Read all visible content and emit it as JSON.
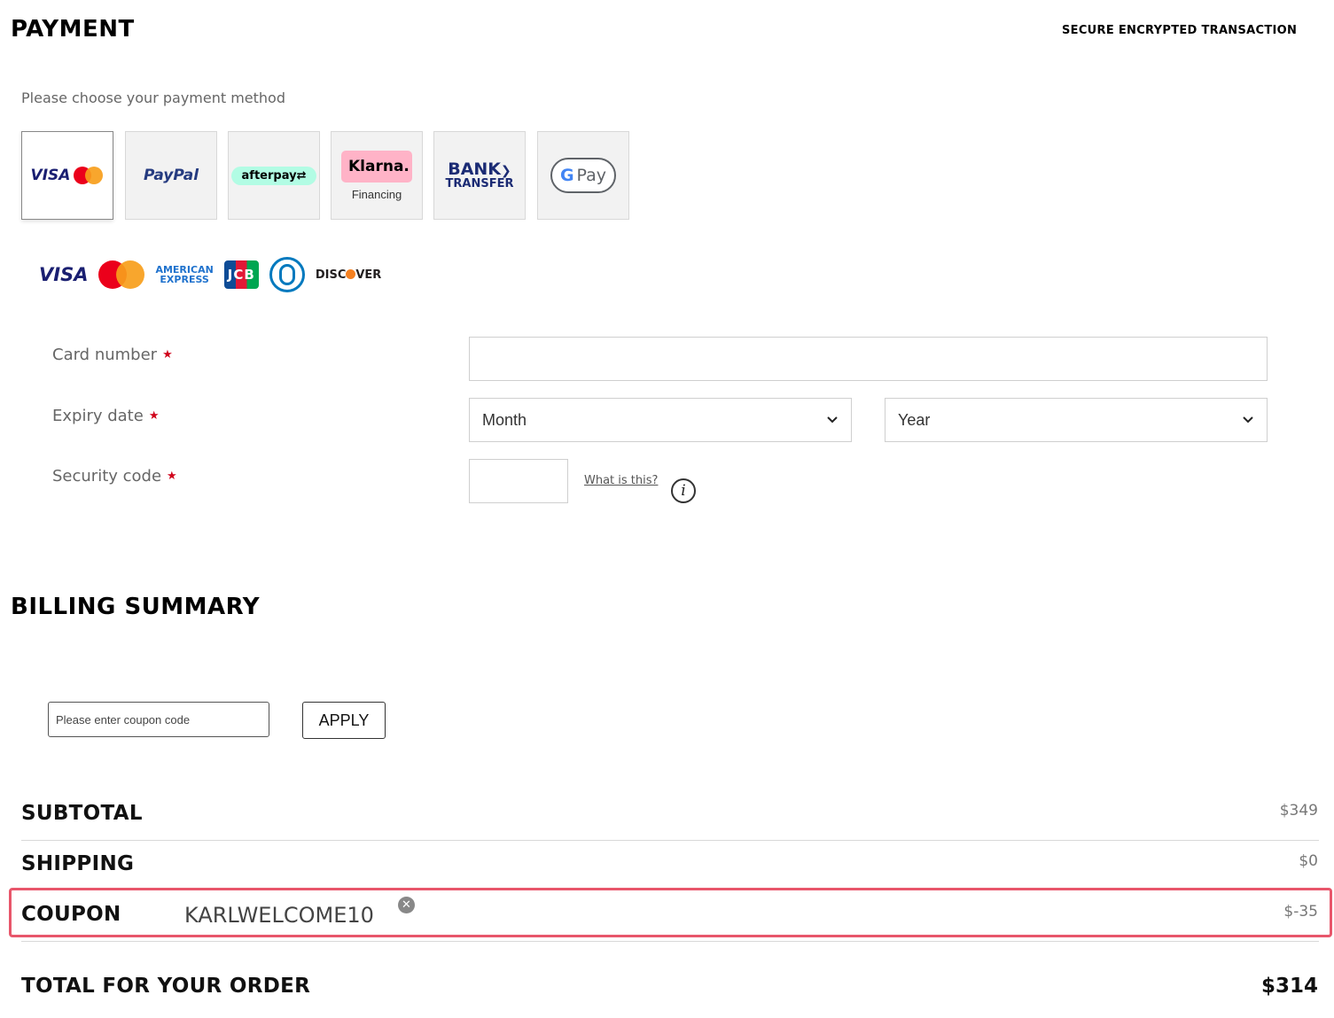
{
  "payment": {
    "title": "PAYMENT",
    "secure_label": "SECURE ENCRYPTED TRANSACTION",
    "choose_label": "Please choose your payment method",
    "methods": [
      {
        "id": "card",
        "label": "VISA",
        "selected": true
      },
      {
        "id": "paypal",
        "label": "PayPal"
      },
      {
        "id": "afterpay",
        "label": "afterpay"
      },
      {
        "id": "klarna",
        "label": "Klarna.",
        "sub": "Financing"
      },
      {
        "id": "bank",
        "label_line1": "BANK",
        "label_line2": "TRANSFER"
      },
      {
        "id": "gpay",
        "label": "Pay"
      }
    ],
    "card_brands": {
      "visa": "VISA",
      "amex_line1": "AMERICAN",
      "amex_line2": "EXPRESS",
      "jcb": "JCB",
      "discover_pre": "DISC",
      "discover_post": "VER"
    },
    "form": {
      "card_number_label": "Card number",
      "expiry_label": "Expiry date",
      "security_label": "Security code",
      "required_mark": "★",
      "month_value": "Month",
      "year_value": "Year",
      "what_is_this": "What is this?",
      "info_glyph": "i"
    }
  },
  "billing": {
    "title": "BILLING SUMMARY",
    "coupon_placeholder": "Please enter coupon code",
    "apply_label": "APPLY",
    "rows": {
      "subtotal_label": "SUBTOTAL",
      "subtotal_value": "$349",
      "shipping_label": "SHIPPING",
      "shipping_value": "$0",
      "coupon_label": "COUPON",
      "coupon_code": "KARLWELCOME10",
      "coupon_value": "$-35",
      "remove_glyph": "✕"
    },
    "total_label": "TOTAL FOR YOUR ORDER",
    "total_value": "$314"
  },
  "colors": {
    "highlight": "#e8566b",
    "required": "#d0021b",
    "visa_blue": "#1a1f71",
    "mc_red": "#eb001b",
    "mc_orange": "#f79e1b",
    "afterpay_mint": "#b2fce4",
    "klarna_pink": "#ffb3c7",
    "bank_navy": "#1b2b74"
  }
}
